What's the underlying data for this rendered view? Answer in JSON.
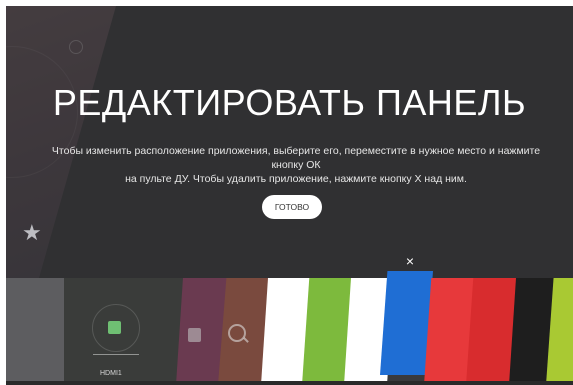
{
  "dialog": {
    "title": "РЕДАКТИРОВАТЬ ПАНЕЛЬ",
    "description_line1": "Чтобы изменить расположение приложения, выберите его, переместите в нужное место и нажмите кнопку ОК",
    "description_line2": "на пульте ДУ. Чтобы удалить приложение, нажмите кнопку Х над ним.",
    "done_button": "ГОТОВО",
    "close_glyph": "×"
  },
  "launcher": {
    "star_glyph": "★",
    "tiles": [
      {
        "name": "gray",
        "color": "#5d5d60"
      },
      {
        "name": "hdmi",
        "label": "HDMI1",
        "color": "#3a3c3a"
      },
      {
        "name": "store",
        "icon": "store-icon",
        "color": "#6a3a50"
      },
      {
        "name": "search",
        "icon": "search-icon",
        "color": "#7a4a3e"
      },
      {
        "name": "white",
        "color": "#ffffff"
      },
      {
        "name": "green",
        "color": "#7dba3d"
      },
      {
        "name": "white",
        "color": "#ffffff"
      },
      {
        "name": "blue-selected",
        "color": "#1f6ed4"
      },
      {
        "name": "red",
        "color": "#e7393b"
      },
      {
        "name": "red",
        "color": "#d82c2e"
      },
      {
        "name": "black",
        "color": "#1e1e1e"
      },
      {
        "name": "lime",
        "color": "#a9c933"
      }
    ]
  }
}
